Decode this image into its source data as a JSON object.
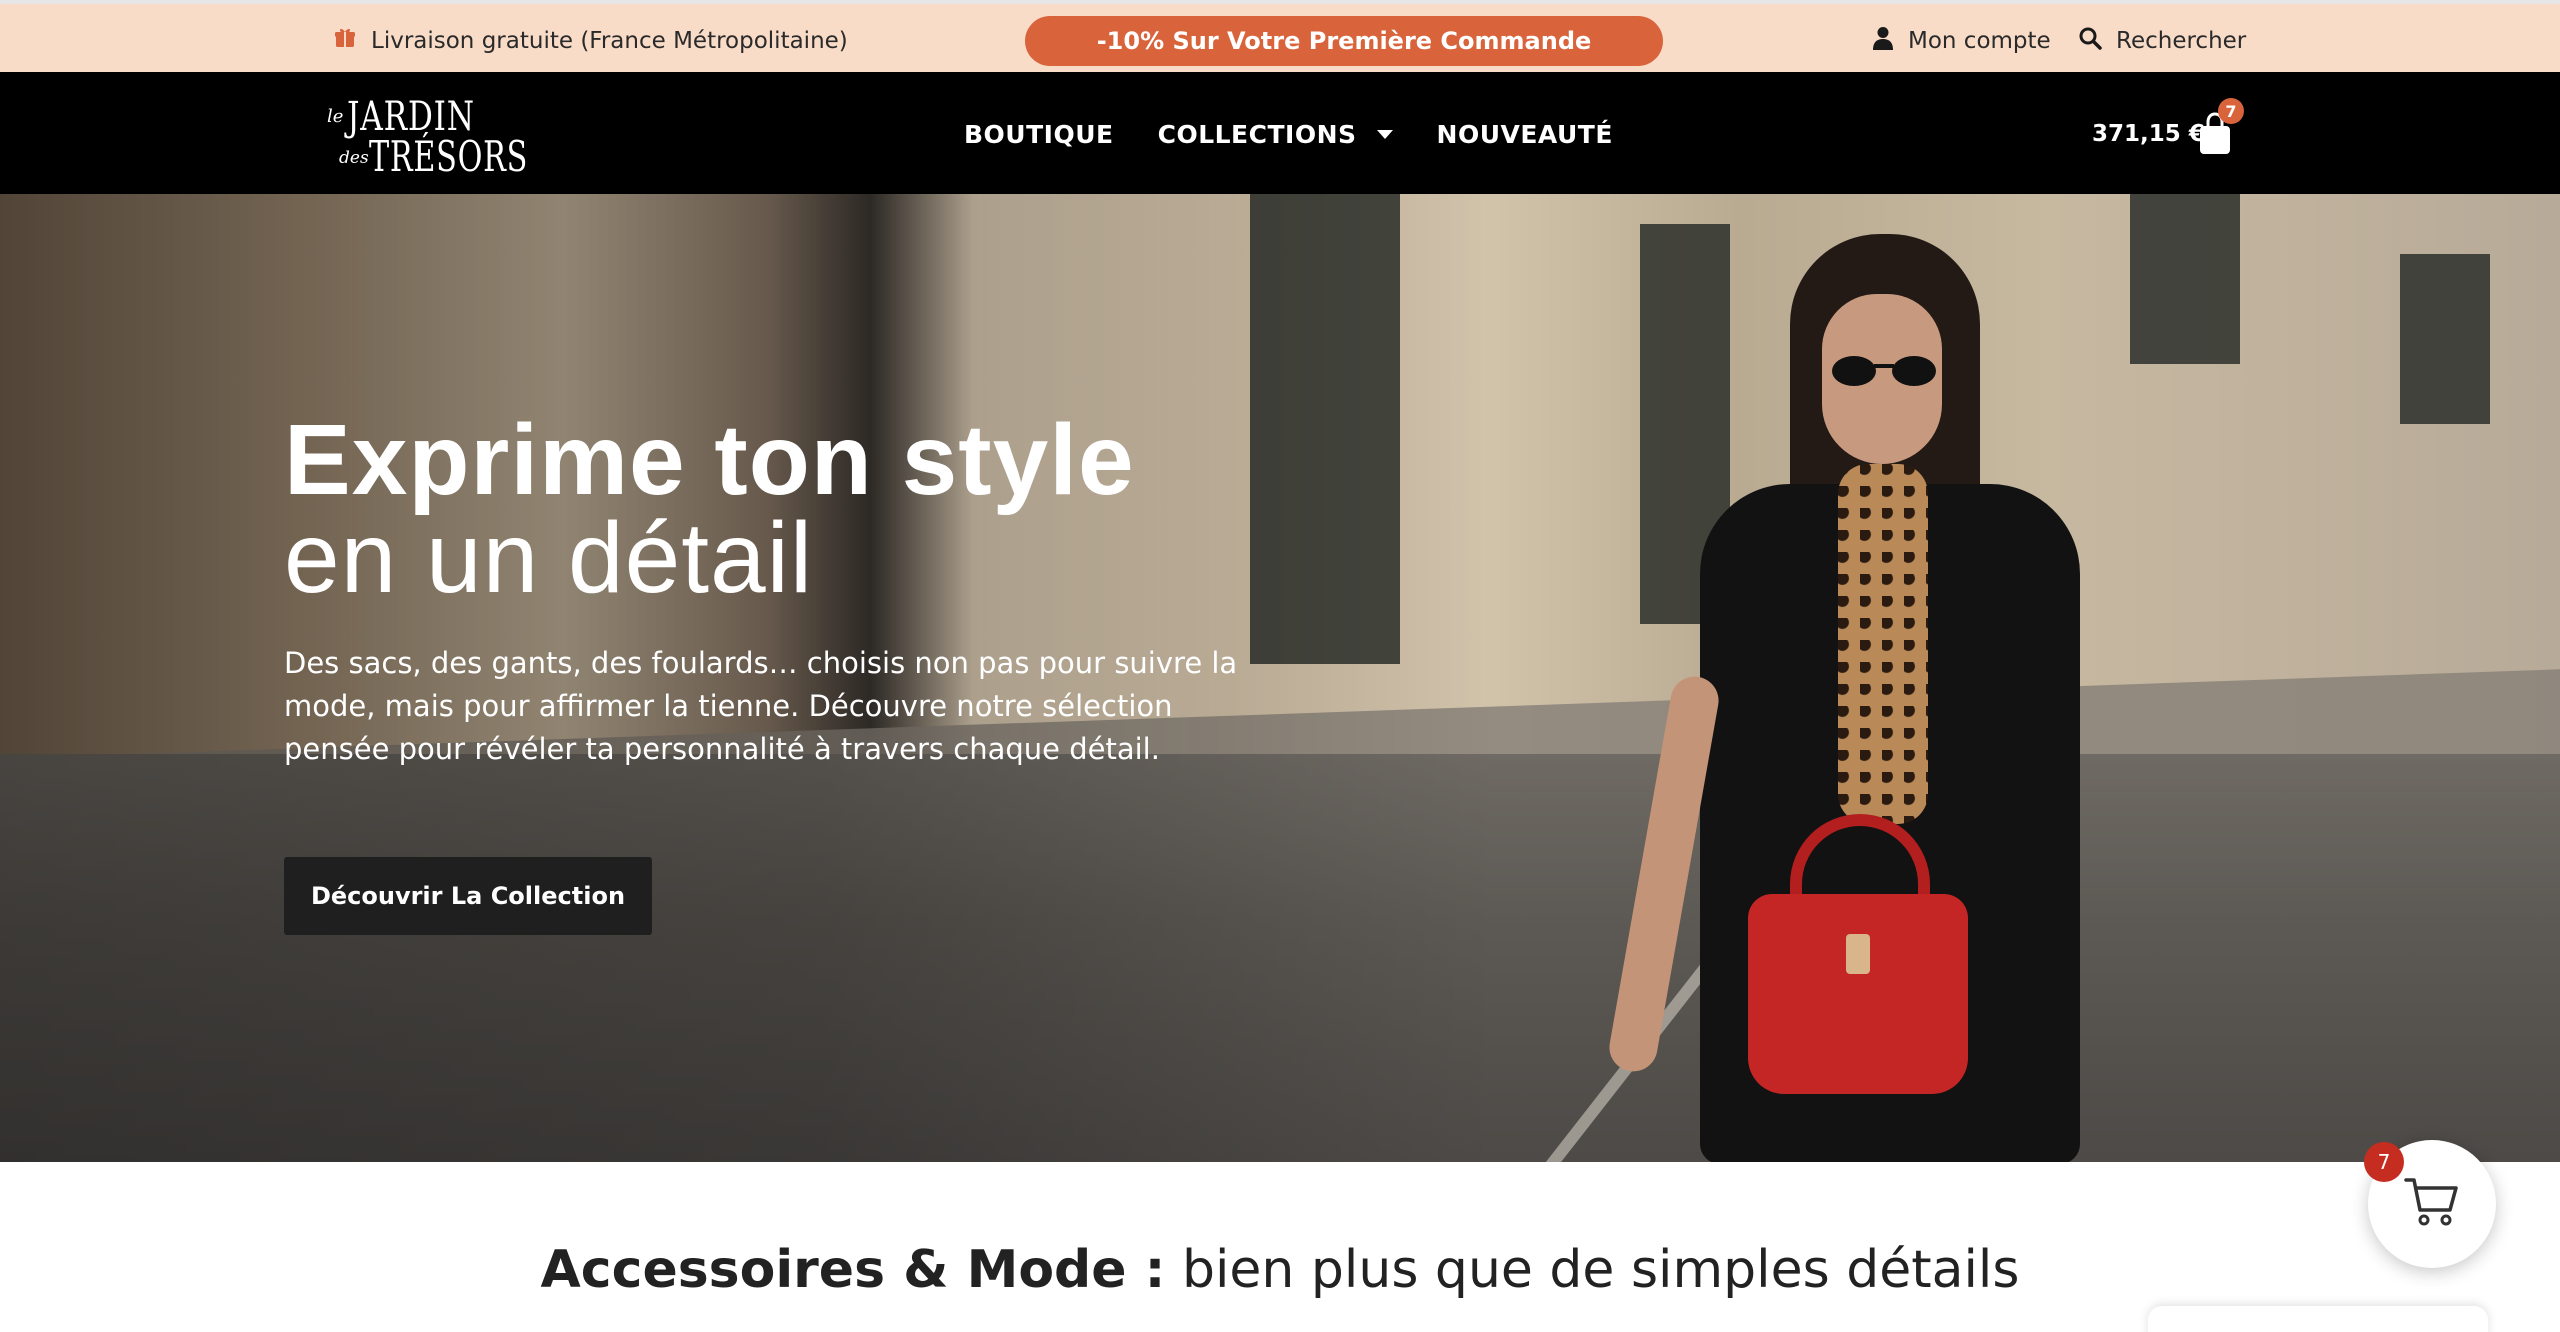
{
  "topbar": {
    "shipping_text": "Livraison gratuite (France Métropolitaine)",
    "shipping_icon": "gift-icon",
    "promo_label": "-10% Sur Votre Première Commande",
    "account_label": "Mon compte",
    "account_icon": "user-icon",
    "search_label": "Rechercher",
    "search_icon": "search-icon"
  },
  "header": {
    "logo": {
      "le": "le",
      "jardin": "JARDIN",
      "des": "des",
      "tresors": "TRÉSORS"
    },
    "nav": [
      {
        "label": "BOUTIQUE"
      },
      {
        "label": "COLLECTIONS",
        "has_dropdown": true
      },
      {
        "label": "NOUVEAUTÉ"
      }
    ],
    "cart_total": "371,15 €",
    "cart_count": "7",
    "cart_icon": "shopping-bag-icon"
  },
  "hero": {
    "title_line1": "Exprime ton style",
    "title_line2": "en un détail",
    "description": "Des sacs, des gants, des foulards… choisis non pas pour suivre la mode, mais pour affirmer la tienne. Découvre notre sélection pensée pour révéler ta personnalité à travers chaque détail.",
    "cta_label": "Découvrir La Collection"
  },
  "section": {
    "heading_strong": "Accessoires & Mode :",
    "heading_light": " bien plus que de simples détails"
  },
  "floating_cart": {
    "count": "7",
    "icon": "cart-icon"
  },
  "colors": {
    "topbar_bg": "#f9dcc8",
    "accent": "#d9643c",
    "header_bg": "#000000",
    "cta_bg": "#1f1f1f",
    "badge_red": "#c62d21"
  }
}
